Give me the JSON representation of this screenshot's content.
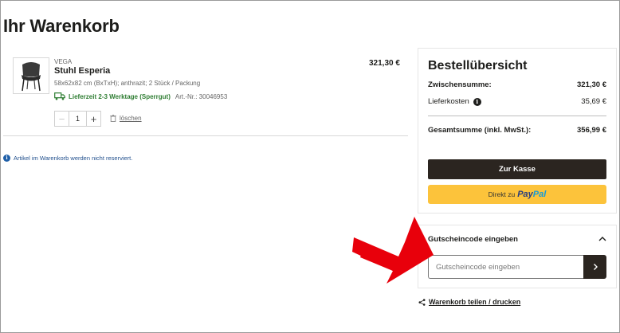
{
  "page": {
    "title": "Ihr Warenkorb"
  },
  "cart": {
    "item": {
      "brand": "VEGA",
      "name": "Stuhl Esperia",
      "description": "58x62x82 cm (BxTxH); anthrazit; 2 Stück / Packung",
      "delivery": "Lieferzeit 2-3 Werktage (Sperrgut)",
      "article_number": "Art.-Nr.: 30046953",
      "price": "321,30 €",
      "quantity": "1",
      "delete_label": "löschen"
    },
    "notice": "Artikel im Warenkorb werden nicht reserviert."
  },
  "summary": {
    "title": "Bestellübersicht",
    "subtotal_label": "Zwischensumme:",
    "subtotal_value": "321,30 €",
    "shipping_label": "Lieferkosten",
    "shipping_value": "35,69 €",
    "total_label": "Gesamtsumme (inkl. MwSt.):",
    "total_value": "356,99 €",
    "checkout_label": "Zur Kasse",
    "paypal_prefix": "Direkt zu",
    "paypal_brand_1": "Pay",
    "paypal_brand_2": "Pal"
  },
  "voucher": {
    "title": "Gutscheincode eingeben",
    "placeholder": "Gutscheincode eingeben"
  },
  "share": {
    "label": "Warenkorb teilen / drucken"
  },
  "colors": {
    "primary_dark": "#2b2520",
    "paypal_yellow": "#fcc33b",
    "delivery_green": "#2e7d32",
    "annotation_red": "#e8000b"
  },
  "icons": {
    "product": "chair-icon",
    "delivery": "truck-icon",
    "delete": "trash-icon",
    "notice": "info-icon",
    "shipping": "info-icon",
    "collapse": "chevron-up-icon",
    "submit": "chevron-right-icon",
    "share": "share-icon"
  }
}
